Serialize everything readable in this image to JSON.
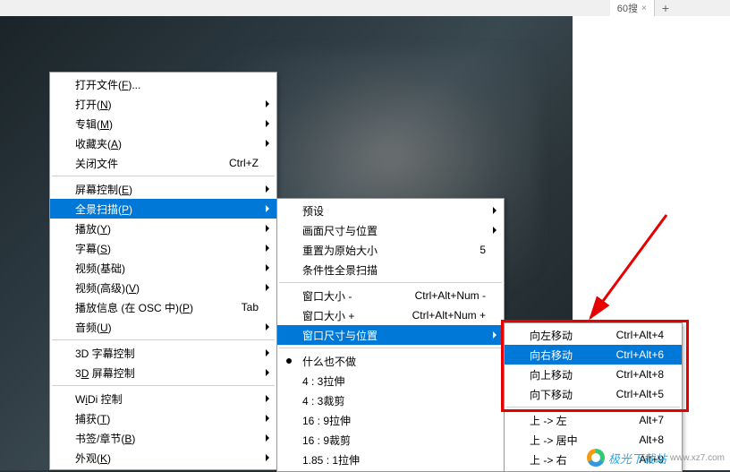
{
  "tab": {
    "label": "60搜",
    "close": "×",
    "plus": "+"
  },
  "menu1": [
    {
      "label": "打开文件(",
      "u": "F",
      "suffix": ")...",
      "shortcut": "",
      "arrow": false
    },
    {
      "label": "打开(",
      "u": "N",
      "suffix": ")",
      "shortcut": "",
      "arrow": true
    },
    {
      "label": "专辑(",
      "u": "M",
      "suffix": ")",
      "shortcut": "",
      "arrow": true
    },
    {
      "label": "收藏夹(",
      "u": "A",
      "suffix": ")",
      "shortcut": "",
      "arrow": true
    },
    {
      "label": "关闭文件",
      "u": "",
      "suffix": "",
      "shortcut": "Ctrl+Z",
      "arrow": false
    },
    {
      "sep": true
    },
    {
      "label": "屏幕控制(",
      "u": "E",
      "suffix": ")",
      "shortcut": "",
      "arrow": true
    },
    {
      "label": "全景扫描(",
      "u": "P",
      "suffix": ")",
      "shortcut": "",
      "arrow": true,
      "hl": true
    },
    {
      "label": "播放(",
      "u": "Y",
      "suffix": ")",
      "shortcut": "",
      "arrow": true
    },
    {
      "label": "字幕(",
      "u": "S",
      "suffix": ")",
      "shortcut": "",
      "arrow": true
    },
    {
      "label": "视频(基础)",
      "u": "",
      "suffix": "",
      "shortcut": "",
      "arrow": true
    },
    {
      "label": "视频(高级)(",
      "u": "V",
      "suffix": ")",
      "shortcut": "",
      "arrow": true
    },
    {
      "label": "播放信息 (在 OSC 中)(",
      "u": "P",
      "suffix": ")",
      "shortcut": "Tab",
      "arrow": false
    },
    {
      "label": "音频(",
      "u": "U",
      "suffix": ")",
      "shortcut": "",
      "arrow": true
    },
    {
      "sep": true
    },
    {
      "label": "3D 字幕控制",
      "u": "",
      "suffix": "",
      "shortcut": "",
      "arrow": true
    },
    {
      "label": "3",
      "u": "D",
      "suffix": " 屏幕控制",
      "shortcut": "",
      "arrow": true
    },
    {
      "sep": true
    },
    {
      "label": "W",
      "u": "i",
      "suffix": "Di 控制",
      "shortcut": "",
      "arrow": true
    },
    {
      "label": "捕获(",
      "u": "T",
      "suffix": ")",
      "shortcut": "",
      "arrow": true
    },
    {
      "label": "书签/章节(",
      "u": "B",
      "suffix": ")",
      "shortcut": "",
      "arrow": true
    },
    {
      "label": "外观(",
      "u": "K",
      "suffix": ")",
      "shortcut": "",
      "arrow": true
    }
  ],
  "menu2": [
    {
      "label": "预设",
      "shortcut": "",
      "arrow": true
    },
    {
      "label": "画面尺寸与位置",
      "shortcut": "",
      "arrow": true
    },
    {
      "label": "重置为原始大小",
      "shortcut": "5",
      "arrow": false
    },
    {
      "label": "条件性全景扫描",
      "shortcut": "",
      "arrow": false
    },
    {
      "sep": true
    },
    {
      "label": "窗口大小 -",
      "shortcut": "Ctrl+Alt+Num -",
      "arrow": false
    },
    {
      "label": "窗口大小 +",
      "shortcut": "Ctrl+Alt+Num +",
      "arrow": false
    },
    {
      "label": "窗口尺寸与位置",
      "shortcut": "",
      "arrow": true,
      "hl": true
    },
    {
      "sep": true
    },
    {
      "label": "什么也不做",
      "shortcut": "",
      "arrow": false,
      "radio": true
    },
    {
      "label": "4 : 3拉伸",
      "shortcut": "",
      "arrow": false
    },
    {
      "label": "4 : 3裁剪",
      "shortcut": "",
      "arrow": false
    },
    {
      "label": "16 : 9拉伸",
      "shortcut": "",
      "arrow": false
    },
    {
      "label": "16 : 9裁剪",
      "shortcut": "",
      "arrow": false
    },
    {
      "label": "1.85 : 1拉伸",
      "shortcut": "",
      "arrow": false
    }
  ],
  "menu3": [
    {
      "label": "向左移动",
      "shortcut": "Ctrl+Alt+4",
      "arrow": false
    },
    {
      "label": "向右移动",
      "shortcut": "Ctrl+Alt+6",
      "arrow": false,
      "hl": true
    },
    {
      "label": "向上移动",
      "shortcut": "Ctrl+Alt+8",
      "arrow": false
    },
    {
      "label": "向下移动",
      "shortcut": "Ctrl+Alt+5",
      "arrow": false
    },
    {
      "sep": true
    },
    {
      "label": "上 -> 左",
      "shortcut": "Alt+7",
      "arrow": false
    },
    {
      "label": "上 -> 居中",
      "shortcut": "Alt+8",
      "arrow": false
    },
    {
      "label": "上 -> 右",
      "shortcut": "Alt+9",
      "arrow": false
    }
  ],
  "watermark": {
    "text": "极光下载站",
    "site": "www.xz7.com"
  }
}
